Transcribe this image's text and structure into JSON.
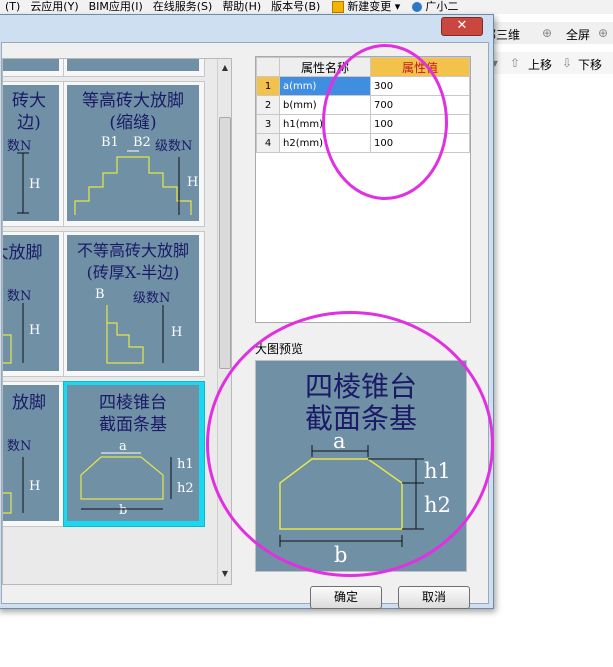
{
  "menubar": {
    "items": [
      "(T)",
      "云应用(Y)",
      "BIM应用(I)",
      "在线服务(S)",
      "帮助(H)",
      "版本号(B)",
      "新建变更",
      "广小二"
    ]
  },
  "background_toolbar": {
    "row1": [
      "部三维",
      "全屏"
    ],
    "row2": [
      "上移",
      "下移"
    ]
  },
  "gallery": {
    "tiles": [
      {
        "title_lines": [
          "砖大",
          "边)"
        ],
        "labels": [
          "数N",
          "H"
        ]
      },
      {
        "title_lines": [
          "等高砖大放脚",
          "(缩缝)"
        ],
        "labels": [
          "B1",
          "B2",
          "级数N",
          "H"
        ]
      },
      {
        "title_lines": [
          "大放脚"
        ],
        "labels": [
          "数N",
          "H"
        ]
      },
      {
        "title_lines": [
          "不等高砖大放脚",
          "(砖厚X-半边)"
        ],
        "labels": [
          "B",
          "级数N",
          "H"
        ]
      },
      {
        "title_lines": [
          "放脚"
        ],
        "labels": [
          "数N",
          "H"
        ]
      },
      {
        "title_lines": [
          "四棱锥台",
          "截面条基"
        ],
        "labels": [
          "a",
          "h1",
          "h2",
          "b"
        ]
      }
    ]
  },
  "property_grid": {
    "headers": [
      "属性名称",
      "属性值"
    ],
    "rows": [
      {
        "num": "1",
        "name": "a(mm)",
        "value": "300"
      },
      {
        "num": "2",
        "name": "b(mm)",
        "value": "700"
      },
      {
        "num": "3",
        "name": "h1(mm)",
        "value": "100"
      },
      {
        "num": "4",
        "name": "h2(mm)",
        "value": "100"
      }
    ]
  },
  "preview": {
    "label": "大图预览",
    "title_lines": [
      "四棱锥台",
      "截面条基"
    ],
    "labels": {
      "a": "a",
      "b": "b",
      "h1": "h1",
      "h2": "h2"
    }
  },
  "buttons": {
    "ok": "确定",
    "cancel": "取消"
  },
  "close_glyph": "✕",
  "colors": {
    "thumb_bg": "#7090a6",
    "selected_border": "#19d8f0",
    "header_value": "#f3c24a",
    "annotation": "#e130e1"
  }
}
